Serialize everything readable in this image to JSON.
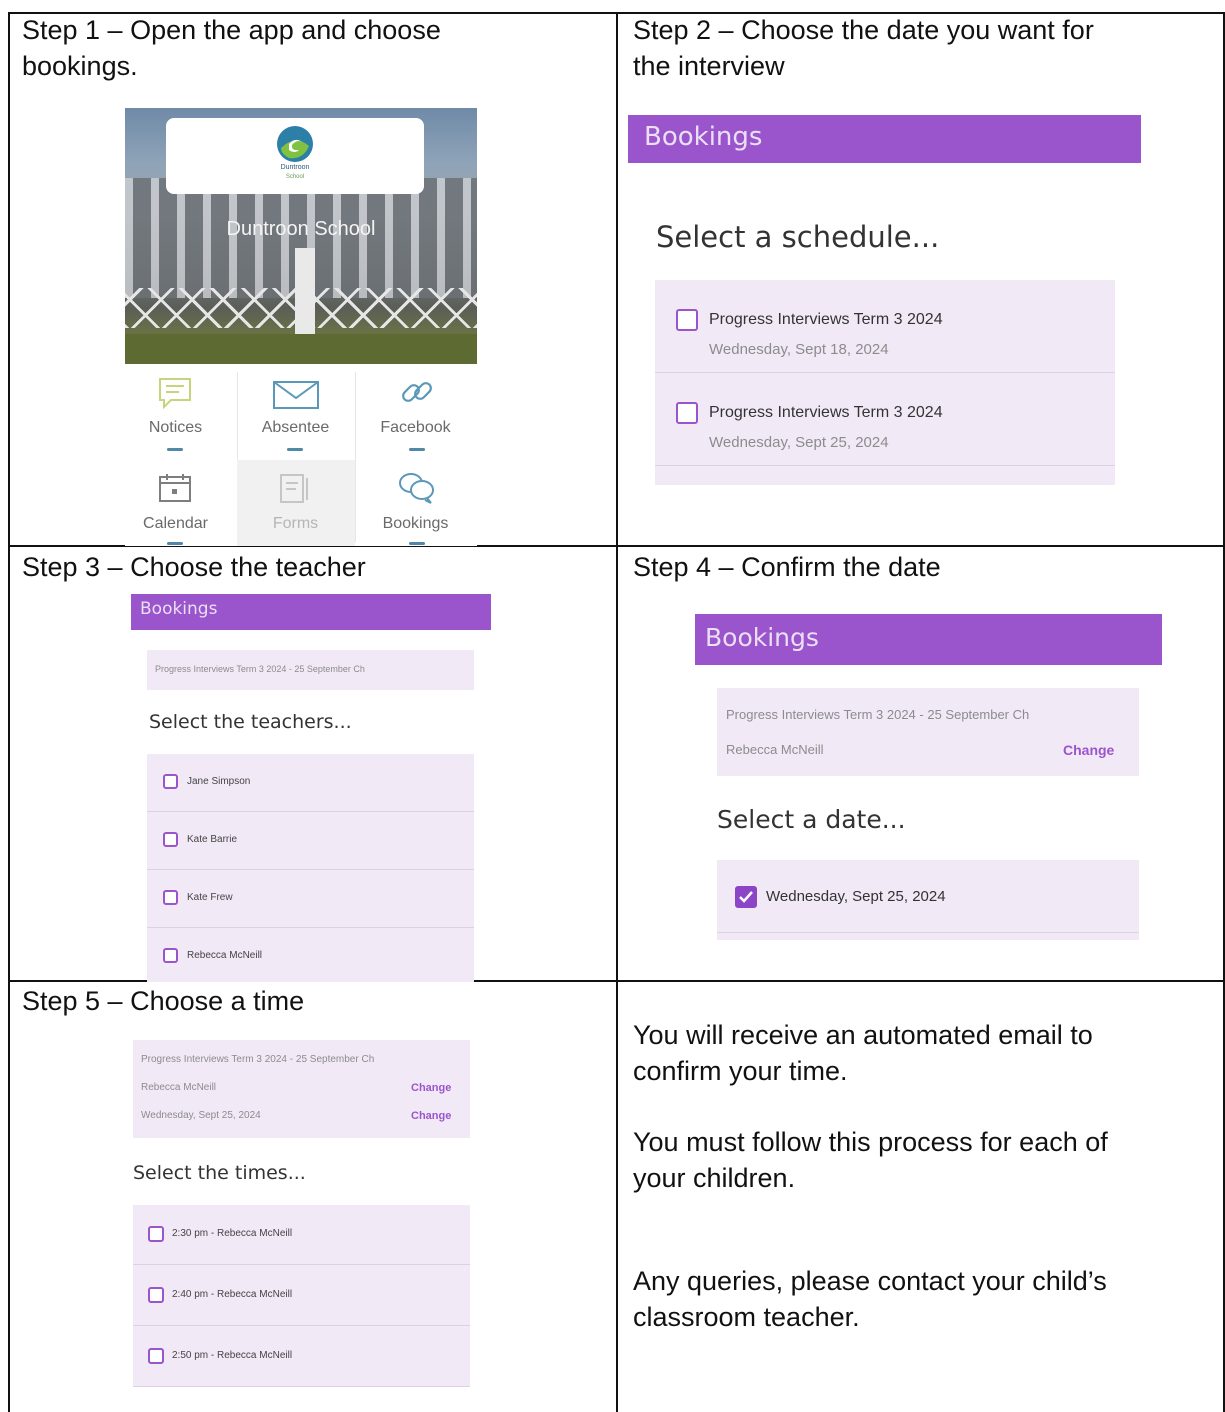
{
  "steps": {
    "s1": {
      "title_line1": "Step 1 – Open the app and choose",
      "title_line2": "bookings."
    },
    "s2": {
      "title_line1": "Step 2 – Choose the date you want for",
      "title_line2": "the interview"
    },
    "s3": {
      "title": "Step 3 – Choose the teacher"
    },
    "s4": {
      "title": "Step 4 – Confirm the date"
    },
    "s5": {
      "title": "Step 5 – Choose a time"
    }
  },
  "app_home": {
    "logo_text": "Duntroon",
    "logo_sub": "School",
    "school_name": "Duntroon School",
    "tiles": [
      {
        "label": "Notices",
        "icon": "chat-icon"
      },
      {
        "label": "Absentee",
        "icon": "envelope-icon"
      },
      {
        "label": "Facebook",
        "icon": "link-icon"
      },
      {
        "label": "Calendar",
        "icon": "calendar-icon"
      },
      {
        "label": "Forms",
        "icon": "form-icon"
      },
      {
        "label": "Bookings",
        "icon": "bookings-icon"
      }
    ]
  },
  "bookings_label": "Bookings",
  "schedule_screen": {
    "heading": "Select a schedule...",
    "items": [
      {
        "title": "Progress Interviews Term 3 2024",
        "date": "Wednesday, Sept 18, 2024"
      },
      {
        "title": "Progress Interviews Term 3 2024",
        "date": "Wednesday, Sept 25, 2024"
      }
    ]
  },
  "teacher_screen": {
    "summary": "Progress Interviews Term 3 2024 - 25 September Ch",
    "heading": "Select the teachers...",
    "teachers": [
      "Jane Simpson",
      "Kate Barrie",
      "Kate Frew",
      "Rebecca McNeill"
    ]
  },
  "date_screen": {
    "summary": "Progress Interviews Term 3 2024 - 25 September Ch",
    "teacher": "Rebecca McNeill",
    "change": "Change",
    "heading": "Select a date...",
    "date": "Wednesday, Sept 25, 2024"
  },
  "time_screen": {
    "summary": "Progress Interviews Term 3 2024 - 25 September Ch",
    "teacher": "Rebecca McNeill",
    "date": "Wednesday, Sept 25, 2024",
    "change": "Change",
    "heading": "Select the times...",
    "times": [
      "2:30 pm - Rebecca McNeill",
      "2:40 pm - Rebecca McNeill",
      "2:50 pm - Rebecca McNeill"
    ]
  },
  "info": {
    "p1_line1": "You will receive an automated email to",
    "p1_line2": "confirm your time.",
    "p2_line1": "You must follow this process for each of",
    "p2_line2": "your children.",
    "p3_line1": "Any queries, please contact your child’s",
    "p3_line2": "classroom teacher."
  }
}
